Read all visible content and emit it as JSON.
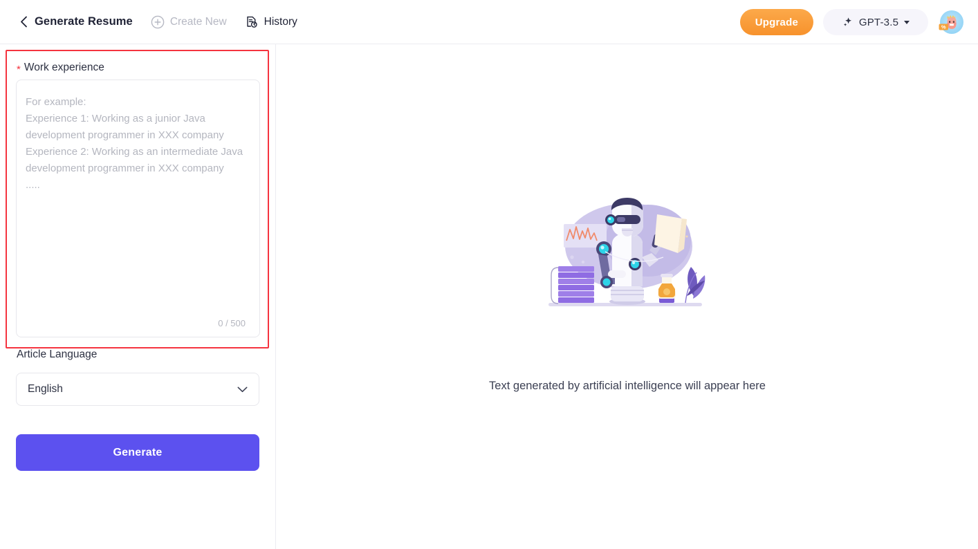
{
  "header": {
    "back_icon": "chevron-left-icon",
    "title": "Generate Resume",
    "create_new": {
      "label": "Create New",
      "icon": "plus-circle-icon"
    },
    "history": {
      "label": "History",
      "icon": "document-clock-icon"
    },
    "upgrade_label": "Upgrade",
    "model": {
      "label": "GPT-3.5",
      "icon": "sparkle-icon",
      "caret": "chevron-down-icon"
    },
    "avatar": {
      "icon": "user-avatar",
      "badge": "%"
    }
  },
  "form": {
    "work_experience": {
      "required_marker": "*",
      "label": "Work experience",
      "placeholder": "For example:\nExperience 1: Working as a junior Java development programmer in XXX company\nExperience 2: Working as an intermediate Java development programmer in XXX company\n.....",
      "value": "",
      "counter": "0 / 500"
    },
    "article_language": {
      "label": "Article Language",
      "value": "English",
      "caret_icon": "chevron-down-icon"
    },
    "generate_label": "Generate"
  },
  "result": {
    "illustration": "ai-robot-illustration",
    "empty_text": "Text generated by artificial intelligence will appear here"
  },
  "colors": {
    "accent": "#5c51ef",
    "upgrade": "#f7922c",
    "highlight": "#f5333f",
    "muted_text": "#b4b6bf"
  }
}
